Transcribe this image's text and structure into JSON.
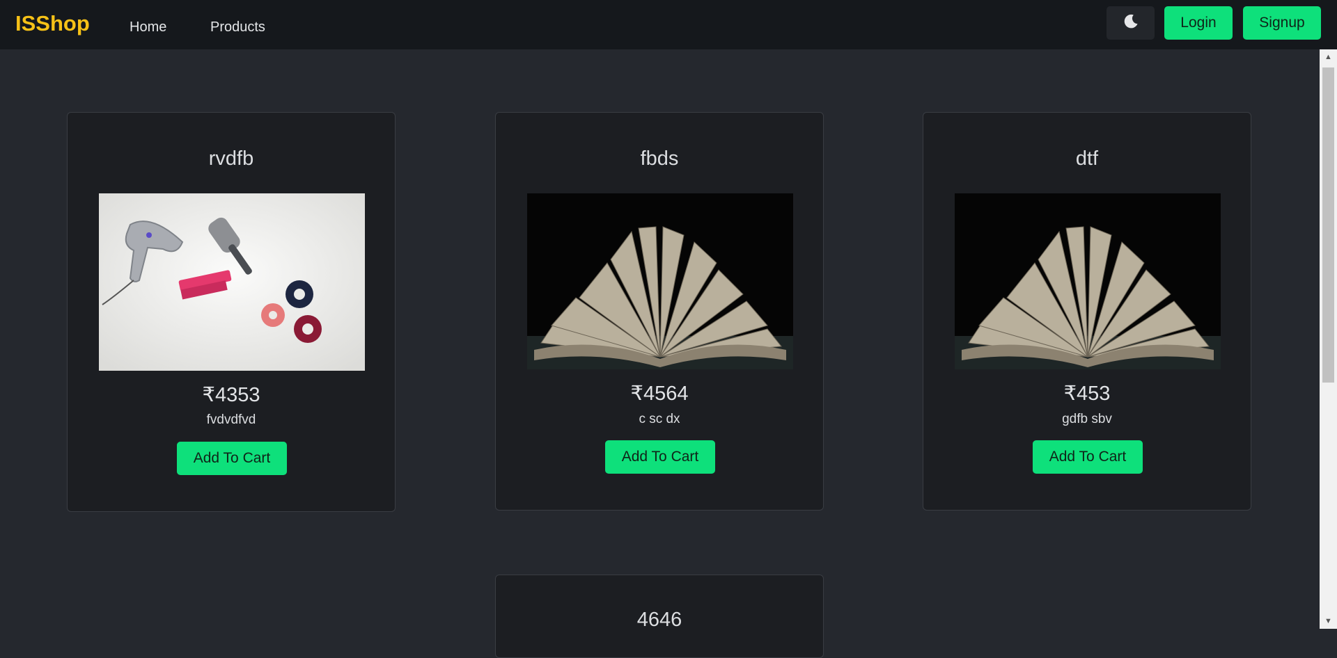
{
  "navbar": {
    "brand": "ISShop",
    "links": [
      "Home",
      "Products"
    ],
    "theme_icon": "moon-icon",
    "login_label": "Login",
    "signup_label": "Signup"
  },
  "colors": {
    "brand": "#f6c117",
    "accent": "#0ee07b",
    "background": "#25282e",
    "card": "#1c1e22"
  },
  "products": [
    {
      "title": "rvdfb",
      "image": "hair-accessories-photo",
      "price": "₹4353",
      "description": "fvdvdfvd",
      "button_label": "Add To Cart"
    },
    {
      "title": "fbds",
      "image": "open-book-photo",
      "price": "₹4564",
      "description": "c sc dx",
      "button_label": "Add To Cart"
    },
    {
      "title": "dtf",
      "image": "open-book-photo",
      "price": "₹453",
      "description": "gdfb sbv",
      "button_label": "Add To Cart"
    },
    {
      "title": "4646"
    }
  ]
}
